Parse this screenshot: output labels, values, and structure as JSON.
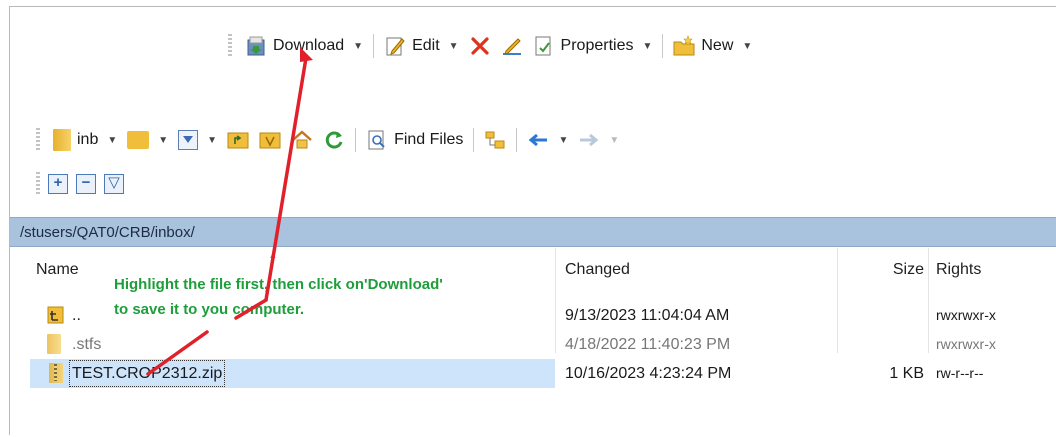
{
  "toolbar1": {
    "download": "Download",
    "edit": "Edit",
    "properties": "Properties",
    "new": "New"
  },
  "toolbar2": {
    "folder": "inb",
    "find_files": "Find Files"
  },
  "path": "/stusers/QAT0/CRB/inbox/",
  "columns": {
    "name": "Name",
    "changed": "Changed",
    "size": "Size",
    "rights": "Rights"
  },
  "rows": [
    {
      "name": "..",
      "changed": "9/13/2023 11:04:04 AM",
      "size": "",
      "rights": "rwxrwxr-x"
    },
    {
      "name": ".stfs",
      "changed": "4/18/2022 11:40:23 PM",
      "size": "",
      "rights": "rwxrwxr-x"
    },
    {
      "name": "TEST.CROP2312.zip",
      "changed": "10/16/2023 4:23:24 PM",
      "size": "1 KB",
      "rights": "rw-r--r--"
    }
  ],
  "annotation": {
    "line1": "Highlight the file first, then click on'Download'",
    "line2": "to save it to you computer."
  },
  "colors": {
    "path_bar": "#a9c2dd",
    "selection": "#cde4fb",
    "annotation": "#1e9e3a",
    "arrow": "#e0202a"
  }
}
